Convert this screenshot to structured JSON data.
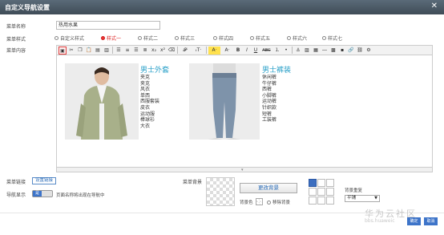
{
  "window": {
    "title": "自定义导航设置",
    "close_glyph": "✕"
  },
  "labels": {
    "menu_name": "菜单名称",
    "menu_style": "菜单样式",
    "menu_content": "菜单内容",
    "menu_link": "菜单链接",
    "nav_display": "导航显示",
    "menu_bg": "菜单背景",
    "bg_color": "背景色",
    "bg_repeat": "背景重复"
  },
  "menu_name_value": "热用水果",
  "styles": [
    {
      "label": "自定义样式",
      "selected": false
    },
    {
      "label": "样式一",
      "selected": true
    },
    {
      "label": "样式二",
      "selected": false
    },
    {
      "label": "样式三",
      "selected": false
    },
    {
      "label": "样式四",
      "selected": false
    },
    {
      "label": "样式五",
      "selected": false
    },
    {
      "label": "样式六",
      "selected": false
    },
    {
      "label": "样式七",
      "selected": false
    }
  ],
  "toolbar": [
    "source-icon",
    "cut-icon",
    "copy-icon",
    "paste-icon",
    "paste-text-icon",
    "paste-word-icon",
    "align-left-icon",
    "align-center-icon",
    "align-right-icon",
    "align-justify-icon",
    "subscript-icon",
    "superscript-icon",
    "clear-format-icon",
    "font-family-icon",
    "font-size-icon",
    "font-color-icon",
    "bg-color-icon",
    "bold-icon",
    "italic-icon",
    "underline-icon",
    "strikethrough-icon",
    "ordered-list-icon",
    "unordered-list-icon",
    "image-icon",
    "table-icon",
    "hr-icon",
    "link-icon",
    "unlink-icon",
    "anchor-icon"
  ],
  "toolbar_glyphs": {
    "bold": "B",
    "italic": "I",
    "underline": "U",
    "strike": "ABC",
    "font": "𝓕·",
    "size": "ₜT·",
    "color": "A·",
    "bg": "A·"
  },
  "content": {
    "left": {
      "title": "男士外套",
      "items": [
        "夹克",
        "夹克",
        "风衣",
        "单西",
        "西服套装",
        "皮衣",
        "运动服",
        "棒球衫",
        "大衣"
      ]
    },
    "right": {
      "title": "男士裤装",
      "items": [
        "休闲裤",
        "牛仔裤",
        "西裤",
        "小脚裤",
        "运动裤",
        "针织款",
        "短裤",
        "工装裤"
      ]
    }
  },
  "bind_link_button": "设置链接",
  "nav_toggle": {
    "state_label": "是",
    "description": "页面名称将出现在导航中"
  },
  "change_bg_button": "更改背景",
  "remove_bg_label": "移除背景",
  "bg_repeat_value": "平铺",
  "bg_position_selected": [
    0,
    0
  ],
  "buttons": {
    "ok": "确定",
    "cancel": "取消"
  },
  "watermark": {
    "text": "华为云社区",
    "url": "bbs.huaweic"
  }
}
